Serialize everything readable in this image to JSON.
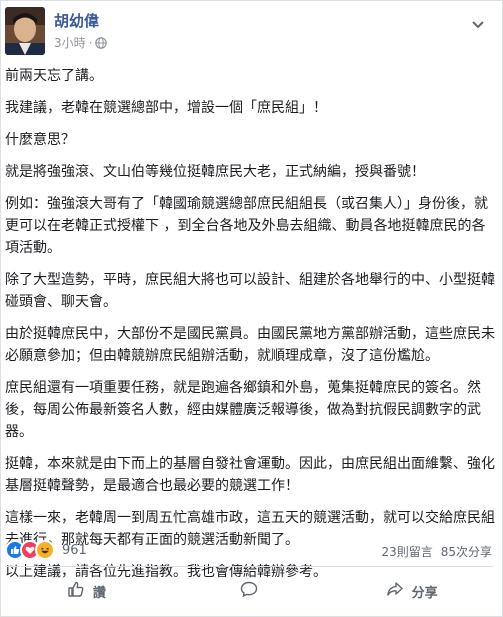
{
  "post": {
    "author": "胡幼偉",
    "time": "3小時",
    "paragraphs": [
      "前兩天忘了講。",
      "我建議，老韓在競選總部中，增設一個「庶民組」！",
      "什麼意思？",
      "就是將強強滾、文山伯等幾位挺韓庶民大老，正式納編，授與番號！",
      "例如：強強滾大哥有了「韓國瑜競選總部庶民組組長（或召集人）」身份後，就更可以在老韓正式授權下 ，到全台各地及外島去組織、動員各地挺韓庶民的各項活動。",
      "除了大型造勢，平時，庶民組大將也可以設計、組建於各地舉行的中、小型挺韓碰頭會、聊天會。",
      "由於挺韓庶民中，大部份不是國民黨員。由國民黨地方黨部辦活動，這些庶民未必願意參加；但由韓競辦庶民組辦活動，就順理成章，沒了這份尷尬。",
      "庶民組還有一項重要任務，就是跑遍各鄉鎮和外島，蒐集挺韓庶民的簽名。然後，每周公佈最新簽名人數，經由媒體廣泛報導後，做為對抗假民調數字的武器。",
      "挺韓，本來就是由下而上的基層自發社會運動。因此，由庶民組出面維繫、強化基層挺韓聲勢，是最適合也最必要的競選工作！",
      "這樣一來，老韓周一到周五忙高雄市政，這五天的競選活動，就可以交給庶民組去進行。那就每天都有正面的競選活動新聞了。",
      "以上建議，請各位先進指教。我也會傳給韓辦參考。"
    ]
  },
  "reactions": {
    "count": "961",
    "comments": "23則留言",
    "shares": "85次分享"
  },
  "actions": {
    "like_label": "讚",
    "share_label": "分享"
  },
  "colors": {
    "author": "#385898",
    "meta": "#90949c",
    "like": "#1877f2",
    "love": "#f33e58",
    "haha": "#f7b125"
  },
  "icons": [
    "avatar",
    "globe-icon",
    "chevron-down-icon",
    "like-reaction-icon",
    "love-reaction-icon",
    "haha-reaction-icon",
    "thumbs-up-icon",
    "comment-icon",
    "share-icon"
  ]
}
